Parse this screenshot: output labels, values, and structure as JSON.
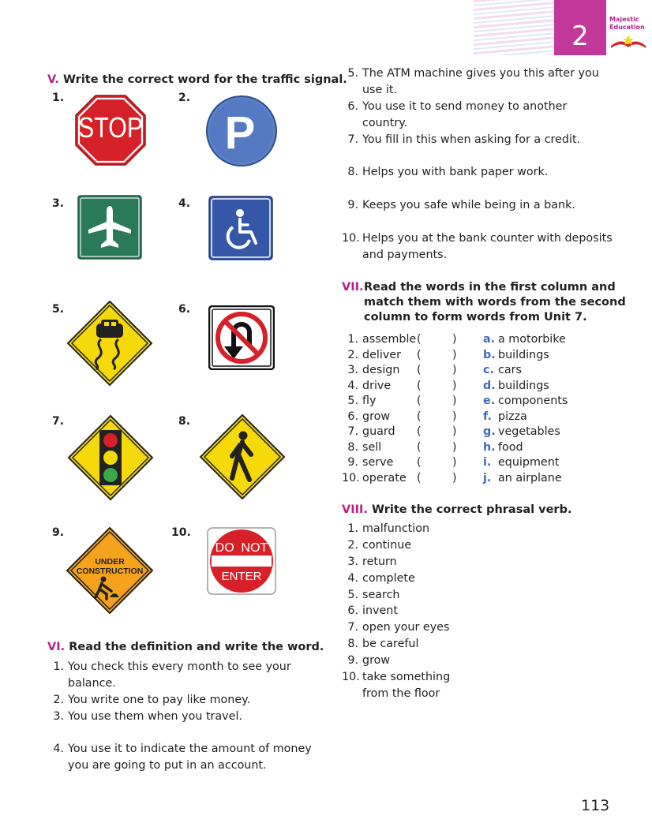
{
  "header": {
    "unit_number": "2",
    "brand_line1": "Majestic",
    "brand_line2": "Education"
  },
  "section5": {
    "roman": "V.",
    "title": "Write the correct word for the traffic signal.",
    "signs": [
      {
        "num": "1.",
        "icon": "stop-sign",
        "text": "STOP"
      },
      {
        "num": "2.",
        "icon": "parking-sign",
        "text": "P"
      },
      {
        "num": "3.",
        "icon": "airport-sign"
      },
      {
        "num": "4.",
        "icon": "wheelchair-sign"
      },
      {
        "num": "5.",
        "icon": "slippery-road-sign"
      },
      {
        "num": "6.",
        "icon": "no-u-turn-sign"
      },
      {
        "num": "7.",
        "icon": "traffic-light-sign"
      },
      {
        "num": "8.",
        "icon": "pedestrian-crossing-sign"
      },
      {
        "num": "9.",
        "icon": "under-construction-sign",
        "text": "UNDER CONSTRUCTION"
      },
      {
        "num": "10.",
        "icon": "do-not-enter-sign",
        "text_top": "DO  NOT",
        "text_bottom": "ENTER"
      }
    ]
  },
  "section6": {
    "roman": "VI.",
    "title": "Read the definition and write the word.",
    "items": [
      {
        "num": "1.",
        "lines": [
          "You check this every month to see your",
          "balance."
        ]
      },
      {
        "num": "2.",
        "lines": [
          "You write one to pay like money."
        ]
      },
      {
        "num": "3.",
        "lines": [
          "You use them when you travel."
        ]
      },
      {
        "num": "4.",
        "lines": [
          "You use it to indicate the amount of money",
          "you are going to put in an account."
        ]
      },
      {
        "num": "5.",
        "lines": [
          "The ATM machine gives you this after you",
          "use it."
        ]
      },
      {
        "num": "6.",
        "lines": [
          "You use it to send money to another",
          "country."
        ]
      },
      {
        "num": "7.",
        "lines": [
          "You fill in this when asking for a credit."
        ]
      },
      {
        "num": "8.",
        "lines": [
          "Helps you with bank paper work."
        ]
      },
      {
        "num": "9.",
        "lines": [
          "Keeps you safe while being in a bank."
        ]
      },
      {
        "num": "10.",
        "lines": [
          "Helps you at the bank counter with deposits",
          "and payments."
        ]
      }
    ]
  },
  "section7": {
    "roman": "VII.",
    "title_lines": [
      "Read the words in the first column and",
      "match them with words from the second",
      "column to form words from Unit 7."
    ],
    "open_paren": "(",
    "close_paren": ")",
    "rows": [
      {
        "num": "1.",
        "word": "assemble",
        "letter": "a.",
        "match": "a motorbike"
      },
      {
        "num": "2.",
        "word": "deliver",
        "letter": "b.",
        "match": "buildings"
      },
      {
        "num": "3.",
        "word": "design",
        "letter": "c.",
        "match": "cars"
      },
      {
        "num": "4.",
        "word": "drive",
        "letter": "d.",
        "match": "buildings"
      },
      {
        "num": "5.",
        "word": "fly",
        "letter": "e.",
        "match": "components"
      },
      {
        "num": "6.",
        "word": "grow",
        "letter": "f.",
        "match": "pizza"
      },
      {
        "num": "7.",
        "word": "guard",
        "letter": "g.",
        "match": "vegetables"
      },
      {
        "num": "8.",
        "word": "sell",
        "letter": "h.",
        "match": "food"
      },
      {
        "num": "9.",
        "word": "serve",
        "letter": "i.",
        "match": "equipment"
      },
      {
        "num": "10.",
        "word": "operate",
        "letter": "j.",
        "match": "an airplane"
      }
    ]
  },
  "section8": {
    "roman": "VIII.",
    "title": "Write the correct phrasal verb.",
    "items": [
      {
        "num": "1.",
        "lines": [
          "malfunction"
        ]
      },
      {
        "num": "2.",
        "lines": [
          "continue"
        ]
      },
      {
        "num": "3.",
        "lines": [
          "return"
        ]
      },
      {
        "num": "4.",
        "lines": [
          "complete"
        ]
      },
      {
        "num": "5.",
        "lines": [
          "search"
        ]
      },
      {
        "num": "6.",
        "lines": [
          "invent"
        ]
      },
      {
        "num": "7.",
        "lines": [
          "open your eyes"
        ]
      },
      {
        "num": "8.",
        "lines": [
          "be careful"
        ]
      },
      {
        "num": "9.",
        "lines": [
          "grow"
        ]
      },
      {
        "num": "10.",
        "lines": [
          "take something",
          "from the floor"
        ]
      }
    ]
  },
  "footer": {
    "page_number": "113"
  },
  "colors": {
    "accent": "#b5228c",
    "letter_blue": "#3e6bb5",
    "sign_yellow": "#f5d90a",
    "sign_red": "#d72128",
    "sign_green": "#2a7a5a",
    "sign_blue": "#3557a7",
    "sign_orange": "#f5a21c"
  }
}
